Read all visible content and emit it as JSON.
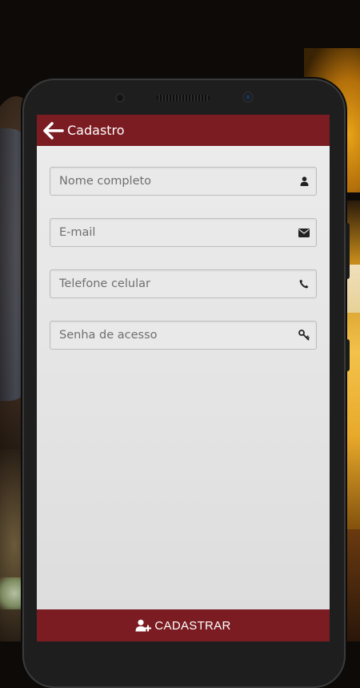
{
  "app": {
    "header": {
      "title": "Cadastro",
      "back_icon": "arrow-left-icon"
    },
    "form": {
      "fields": [
        {
          "placeholder": "Nome completo",
          "value": "",
          "icon": "user-icon"
        },
        {
          "placeholder": "E-mail",
          "value": "",
          "icon": "envelope-icon"
        },
        {
          "placeholder": "Telefone celular",
          "value": "",
          "icon": "phone-icon"
        },
        {
          "placeholder": "Senha de acesso",
          "value": "",
          "icon": "key-icon"
        }
      ]
    },
    "submit": {
      "label": "CADASTRAR",
      "icon": "user-plus-icon"
    },
    "colors": {
      "primary": "#7b1c22",
      "screen_bg": "#e6e6e6",
      "field_border": "#bdbdbd",
      "placeholder": "#6f6f6f"
    }
  }
}
